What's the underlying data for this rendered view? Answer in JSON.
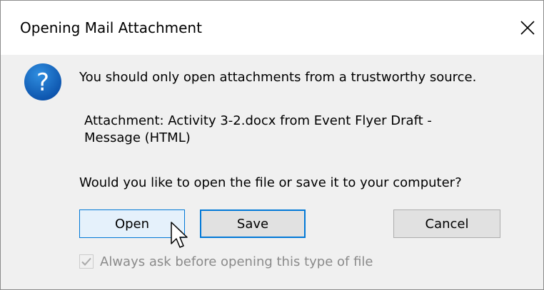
{
  "dialog": {
    "title": "Opening Mail Attachment",
    "message": "You should only open attachments from a trustworthy source.",
    "attachment_line1": "Attachment: Activity 3-2.docx from Event Flyer Draft -",
    "attachment_line2": "Message (HTML)",
    "question": "Would you like to open the file or save it to your computer?",
    "icon": "question-icon",
    "icon_color": "#0a62b8"
  },
  "buttons": {
    "open_label": "Open",
    "save_label": "Save",
    "cancel_label": "Cancel"
  },
  "checkbox": {
    "label": "Always ask before opening this type of file",
    "checked": true,
    "enabled": false
  },
  "colors": {
    "accent": "#0078d7",
    "dialog_bg": "#f0f0f0"
  }
}
